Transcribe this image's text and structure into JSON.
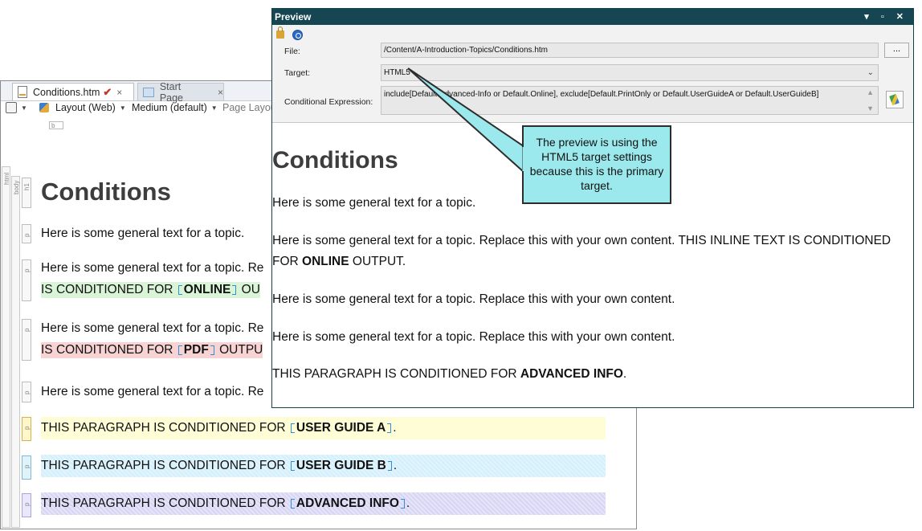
{
  "editor": {
    "tabs": [
      {
        "label": "Conditions.htm",
        "check": "✔",
        "close": "×"
      },
      {
        "label": "Start Page",
        "close": "×"
      }
    ],
    "toolbar": {
      "layout": "Layout (Web)",
      "medium": "Medium (default)",
      "page_layout": "Page Layou"
    },
    "b_marker": "b",
    "rails": {
      "html": "html",
      "body": "body"
    },
    "tags": {
      "h1": "h1",
      "p": "p"
    },
    "heading": "Conditions",
    "paragraphs": {
      "p1": "Here is some general text for a topic.",
      "p2_line1": "Here is some general text for a topic. Re",
      "p2_line2_pre": "IS CONDITIONED FOR",
      "p2_bold": "ONLINE",
      "p2_post": "OU",
      "p3_line1": "Here is some general text for a topic. Re",
      "p3_line2_pre": "IS CONDITIONED FOR",
      "p3_bold": "PDF",
      "p3_post": "OUTPU",
      "p4": "Here is some general text for a topic. Re",
      "p5_pre": "THIS PARAGRAPH IS CONDITIONED FOR",
      "p5_bold": "USER GUIDE A",
      "p6_pre": "THIS PARAGRAPH IS CONDITIONED FOR",
      "p6_bold": "USER GUIDE B",
      "p7_pre": "THIS PARAGRAPH IS CONDITIONED FOR",
      "p7_bold": "ADVANCED INFO",
      "period": "."
    }
  },
  "preview": {
    "title": "Preview",
    "controls": "▾ ▫ ✕",
    "file_label": "File:",
    "file_value": "/Content/A-Introduction-Topics/Conditions.htm",
    "browse_label": "...",
    "target_label": "Target:",
    "target_value": "HTML5",
    "cond_label": "Conditional Expression:",
    "cond_value": "include[Default.Advanced-Info or Default.Online], exclude[Default.PrintOnly or Default.UserGuideA or Default.UserGuideB]",
    "heading": "Conditions",
    "p1": "Here is some general text for a topic.",
    "p2": "Here is some general text for a topic. Replace this with your own content. THIS INLINE TEXT IS CONDITIONED FOR",
    "p2_bold": "ONLINE",
    "p2_end": "OUTPUT.",
    "p3": "Here is some general text for a topic. Replace this with your own content.",
    "p4": "Here is some general text for a topic. Replace this with your own content.",
    "p5": "THIS PARAGRAPH IS CONDITIONED FOR",
    "p5_bold": "ADVANCED INFO",
    "p5_end": "."
  },
  "callout": {
    "text": "The preview is using the HTML5 target settings because this is the primary target."
  },
  "colors": {
    "title_bar": "#154652",
    "callout_fill": "#9be9ec",
    "green_highlight": "#daf4d8",
    "red_highlight": "#f8d3d3",
    "yellow_highlight": "#fefdd6",
    "blue_highlight": "#d3effb",
    "purple_highlight": "#d8d5f4",
    "condition_marker": "#2f8fd6"
  }
}
